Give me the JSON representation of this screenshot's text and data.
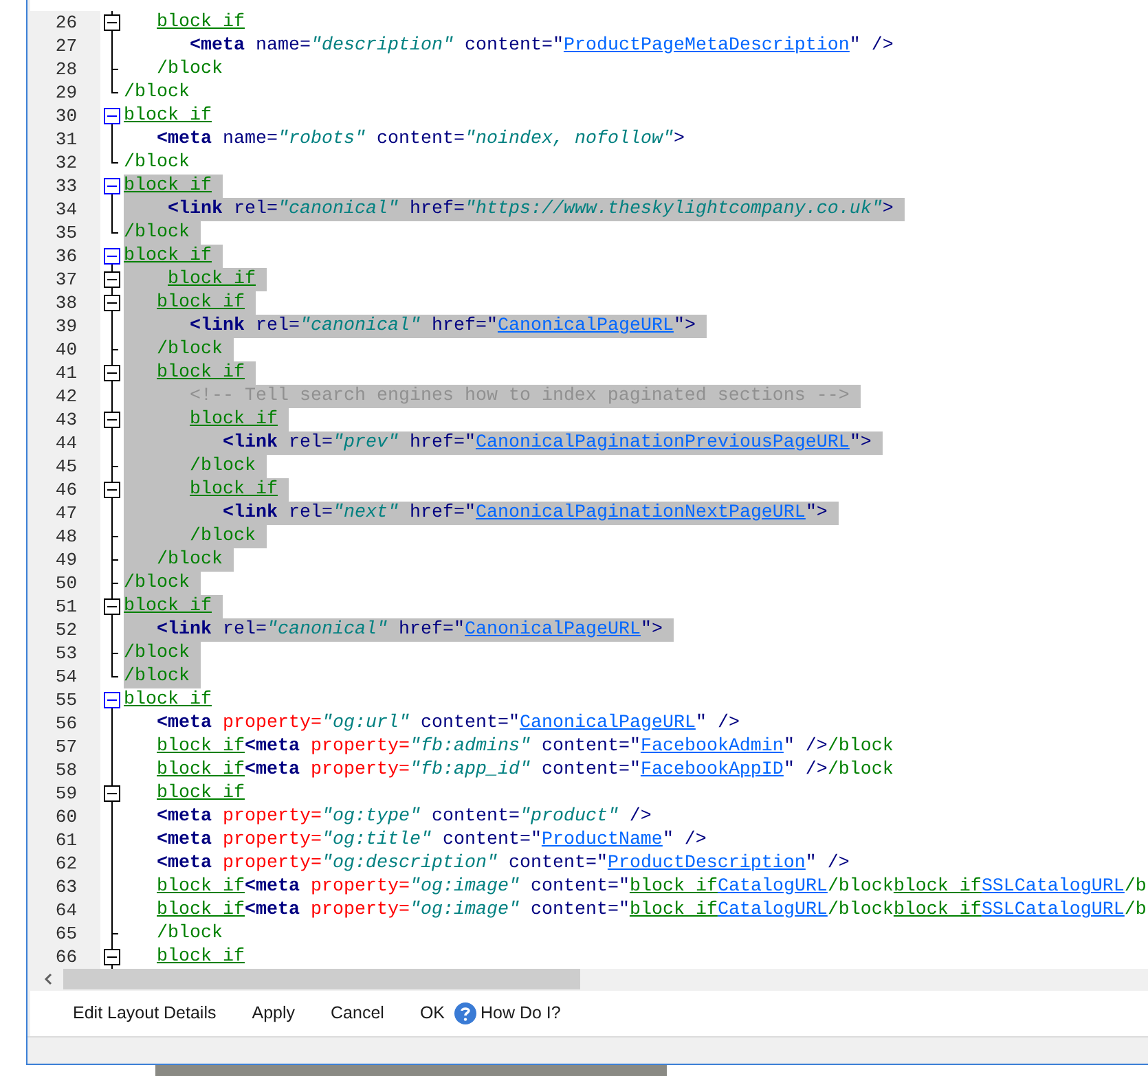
{
  "editor": {
    "lines": [
      {
        "number": "26",
        "kind": "open",
        "selected": false,
        "segments": [
          {
            "kind": "block",
            "text": "   block if"
          }
        ]
      },
      {
        "number": "27",
        "kind": "line",
        "selected": false,
        "segments": [
          {
            "kind": "tag",
            "text": "      <meta"
          },
          {
            "kind": "attr",
            "text": " name="
          },
          {
            "kind": "value",
            "text": "\"description\""
          },
          {
            "kind": "attr",
            "text": " content="
          },
          {
            "kind": "punct",
            "text": "\""
          },
          {
            "kind": "ref",
            "text": "ProductPageMetaDescription"
          },
          {
            "kind": "punct",
            "text": "\" />"
          }
        ]
      },
      {
        "number": "28",
        "kind": "tick",
        "selected": false,
        "segments": [
          {
            "kind": "end",
            "text": "   /block"
          }
        ]
      },
      {
        "number": "29",
        "kind": "end",
        "selected": false,
        "segments": [
          {
            "kind": "end",
            "text": "/block"
          }
        ]
      },
      {
        "number": "30",
        "kind": "open-top",
        "selected": false,
        "segments": [
          {
            "kind": "block",
            "text": "block if"
          }
        ]
      },
      {
        "number": "31",
        "kind": "line",
        "selected": false,
        "segments": [
          {
            "kind": "tag",
            "text": "   <meta"
          },
          {
            "kind": "attr",
            "text": " name="
          },
          {
            "kind": "value",
            "text": "\"robots\""
          },
          {
            "kind": "attr",
            "text": " content="
          },
          {
            "kind": "value",
            "text": "\"noindex, nofollow\""
          },
          {
            "kind": "punct",
            "text": ">"
          }
        ]
      },
      {
        "number": "32",
        "kind": "end",
        "selected": false,
        "segments": [
          {
            "kind": "end",
            "text": "/block"
          }
        ]
      },
      {
        "number": "33",
        "kind": "open-top",
        "selected": true,
        "segments": [
          {
            "kind": "block",
            "text": "block if"
          }
        ]
      },
      {
        "number": "34",
        "kind": "line",
        "selected": true,
        "segments": [
          {
            "kind": "tag",
            "text": "    <link"
          },
          {
            "kind": "attr",
            "text": " rel="
          },
          {
            "kind": "value",
            "text": "\"canonical\""
          },
          {
            "kind": "attr",
            "text": " href="
          },
          {
            "kind": "value",
            "text": "\"https://www.theskylightcompany.co.uk\""
          },
          {
            "kind": "punct",
            "text": ">"
          }
        ]
      },
      {
        "number": "35",
        "kind": "end",
        "selected": true,
        "segments": [
          {
            "kind": "end",
            "text": "/block"
          }
        ]
      },
      {
        "number": "36",
        "kind": "open-top",
        "selected": true,
        "segments": [
          {
            "kind": "block",
            "text": "block if"
          }
        ]
      },
      {
        "number": "37",
        "kind": "open",
        "selected": true,
        "segments": [
          {
            "kind": "block",
            "text": "    block if"
          }
        ]
      },
      {
        "number": "38",
        "kind": "open",
        "selected": true,
        "segments": [
          {
            "kind": "block",
            "text": "   block if"
          }
        ]
      },
      {
        "number": "39",
        "kind": "line",
        "selected": true,
        "segments": [
          {
            "kind": "tag",
            "text": "      <link"
          },
          {
            "kind": "attr",
            "text": " rel="
          },
          {
            "kind": "value",
            "text": "\"canonical\""
          },
          {
            "kind": "attr",
            "text": " href="
          },
          {
            "kind": "punct",
            "text": "\""
          },
          {
            "kind": "ref",
            "text": "CanonicalPageURL"
          },
          {
            "kind": "punct",
            "text": "\">"
          }
        ]
      },
      {
        "number": "40",
        "kind": "tick",
        "selected": true,
        "segments": [
          {
            "kind": "end",
            "text": "   /block"
          }
        ]
      },
      {
        "number": "41",
        "kind": "open",
        "selected": true,
        "segments": [
          {
            "kind": "block",
            "text": "   block if"
          }
        ]
      },
      {
        "number": "42",
        "kind": "line",
        "selected": true,
        "segments": [
          {
            "kind": "comment",
            "text": "      <!-- Tell search engines how to index paginated sections -->"
          }
        ]
      },
      {
        "number": "43",
        "kind": "open",
        "selected": true,
        "segments": [
          {
            "kind": "block",
            "text": "      block if"
          }
        ]
      },
      {
        "number": "44",
        "kind": "line",
        "selected": true,
        "segments": [
          {
            "kind": "tag",
            "text": "         <link"
          },
          {
            "kind": "attr",
            "text": " rel="
          },
          {
            "kind": "value",
            "text": "\"prev\""
          },
          {
            "kind": "attr",
            "text": " href="
          },
          {
            "kind": "punct",
            "text": "\""
          },
          {
            "kind": "ref",
            "text": "CanonicalPaginationPreviousPageURL"
          },
          {
            "kind": "punct",
            "text": "\">"
          }
        ]
      },
      {
        "number": "45",
        "kind": "tick",
        "selected": true,
        "segments": [
          {
            "kind": "end",
            "text": "      /block"
          }
        ]
      },
      {
        "number": "46",
        "kind": "open",
        "selected": true,
        "segments": [
          {
            "kind": "block",
            "text": "      block if"
          }
        ]
      },
      {
        "number": "47",
        "kind": "line",
        "selected": true,
        "segments": [
          {
            "kind": "tag",
            "text": "         <link"
          },
          {
            "kind": "attr",
            "text": " rel="
          },
          {
            "kind": "value",
            "text": "\"next\""
          },
          {
            "kind": "attr",
            "text": " href="
          },
          {
            "kind": "punct",
            "text": "\""
          },
          {
            "kind": "ref",
            "text": "CanonicalPaginationNextPageURL"
          },
          {
            "kind": "punct",
            "text": "\">"
          }
        ]
      },
      {
        "number": "48",
        "kind": "tick",
        "selected": true,
        "segments": [
          {
            "kind": "end",
            "text": "      /block"
          }
        ]
      },
      {
        "number": "49",
        "kind": "tick",
        "selected": true,
        "segments": [
          {
            "kind": "end",
            "text": "   /block"
          }
        ]
      },
      {
        "number": "50",
        "kind": "tick",
        "selected": true,
        "segments": [
          {
            "kind": "end",
            "text": "/block"
          }
        ]
      },
      {
        "number": "51",
        "kind": "open",
        "selected": true,
        "segments": [
          {
            "kind": "block",
            "text": "block if"
          }
        ]
      },
      {
        "number": "52",
        "kind": "line",
        "selected": true,
        "segments": [
          {
            "kind": "tag",
            "text": "   <link"
          },
          {
            "kind": "attr",
            "text": " rel="
          },
          {
            "kind": "value",
            "text": "\"canonical\""
          },
          {
            "kind": "attr",
            "text": " href="
          },
          {
            "kind": "punct",
            "text": "\""
          },
          {
            "kind": "ref",
            "text": "CanonicalPageURL"
          },
          {
            "kind": "punct",
            "text": "\">"
          }
        ]
      },
      {
        "number": "53",
        "kind": "tick",
        "selected": true,
        "segments": [
          {
            "kind": "end",
            "text": "/block"
          }
        ]
      },
      {
        "number": "54",
        "kind": "end",
        "selected": true,
        "segments": [
          {
            "kind": "end",
            "text": "/block"
          }
        ]
      },
      {
        "number": "55",
        "kind": "open-top",
        "selected": false,
        "segments": [
          {
            "kind": "block",
            "text": "block if"
          }
        ]
      },
      {
        "number": "56",
        "kind": "line",
        "selected": false,
        "segments": [
          {
            "kind": "tag",
            "text": "   <meta"
          },
          {
            "kind": "prop",
            "text": " property="
          },
          {
            "kind": "value",
            "text": "\"og:url\""
          },
          {
            "kind": "attr",
            "text": " content="
          },
          {
            "kind": "punct",
            "text": "\""
          },
          {
            "kind": "ref",
            "text": "CanonicalPageURL"
          },
          {
            "kind": "punct",
            "text": "\" />"
          }
        ]
      },
      {
        "number": "57",
        "kind": "line",
        "selected": false,
        "segments": [
          {
            "kind": "block",
            "text": "   block if"
          },
          {
            "kind": "tag",
            "text": "<meta"
          },
          {
            "kind": "prop",
            "text": " property="
          },
          {
            "kind": "value",
            "text": "\"fb:admins\""
          },
          {
            "kind": "attr",
            "text": " content="
          },
          {
            "kind": "punct",
            "text": "\""
          },
          {
            "kind": "ref",
            "text": "FacebookAdmin"
          },
          {
            "kind": "punct",
            "text": "\" />"
          },
          {
            "kind": "end",
            "text": "/block"
          }
        ]
      },
      {
        "number": "58",
        "kind": "line",
        "selected": false,
        "segments": [
          {
            "kind": "block",
            "text": "   block if"
          },
          {
            "kind": "tag",
            "text": "<meta"
          },
          {
            "kind": "prop",
            "text": " property="
          },
          {
            "kind": "value",
            "text": "\"fb:app_id\""
          },
          {
            "kind": "attr",
            "text": " content="
          },
          {
            "kind": "punct",
            "text": "\""
          },
          {
            "kind": "ref",
            "text": "FacebookAppID"
          },
          {
            "kind": "punct",
            "text": "\" />"
          },
          {
            "kind": "end",
            "text": "/block"
          }
        ]
      },
      {
        "number": "59",
        "kind": "open",
        "selected": false,
        "segments": [
          {
            "kind": "block",
            "text": "   block if"
          }
        ]
      },
      {
        "number": "60",
        "kind": "line",
        "selected": false,
        "segments": [
          {
            "kind": "tag",
            "text": "   <meta"
          },
          {
            "kind": "prop",
            "text": " property="
          },
          {
            "kind": "value",
            "text": "\"og:type\""
          },
          {
            "kind": "attr",
            "text": " content="
          },
          {
            "kind": "value",
            "text": "\"product\""
          },
          {
            "kind": "punct",
            "text": " />"
          }
        ]
      },
      {
        "number": "61",
        "kind": "line",
        "selected": false,
        "segments": [
          {
            "kind": "tag",
            "text": "   <meta"
          },
          {
            "kind": "prop",
            "text": " property="
          },
          {
            "kind": "value",
            "text": "\"og:title\""
          },
          {
            "kind": "attr",
            "text": " content="
          },
          {
            "kind": "punct",
            "text": "\""
          },
          {
            "kind": "ref",
            "text": "ProductName"
          },
          {
            "kind": "punct",
            "text": "\" />"
          }
        ]
      },
      {
        "number": "62",
        "kind": "line",
        "selected": false,
        "segments": [
          {
            "kind": "tag",
            "text": "   <meta"
          },
          {
            "kind": "prop",
            "text": " property="
          },
          {
            "kind": "value",
            "text": "\"og:description\""
          },
          {
            "kind": "attr",
            "text": " content="
          },
          {
            "kind": "punct",
            "text": "\""
          },
          {
            "kind": "ref",
            "text": "ProductDescription"
          },
          {
            "kind": "punct",
            "text": "\" />"
          }
        ]
      },
      {
        "number": "63",
        "kind": "line",
        "selected": false,
        "segments": [
          {
            "kind": "block",
            "text": "   block if"
          },
          {
            "kind": "tag",
            "text": "<meta"
          },
          {
            "kind": "prop",
            "text": " property="
          },
          {
            "kind": "value",
            "text": "\"og:image\""
          },
          {
            "kind": "attr",
            "text": " content="
          },
          {
            "kind": "punct",
            "text": "\""
          },
          {
            "kind": "block",
            "text": "block if"
          },
          {
            "kind": "ref",
            "text": "CatalogURL"
          },
          {
            "kind": "end",
            "text": "/block"
          },
          {
            "kind": "block",
            "text": "block if"
          },
          {
            "kind": "ref",
            "text": "SSLCatalogURL"
          },
          {
            "kind": "end",
            "text": "/b"
          }
        ]
      },
      {
        "number": "64",
        "kind": "line",
        "selected": false,
        "segments": [
          {
            "kind": "block",
            "text": "   block if"
          },
          {
            "kind": "tag",
            "text": "<meta"
          },
          {
            "kind": "prop",
            "text": " property="
          },
          {
            "kind": "value",
            "text": "\"og:image\""
          },
          {
            "kind": "attr",
            "text": " content="
          },
          {
            "kind": "punct",
            "text": "\""
          },
          {
            "kind": "block",
            "text": "block if"
          },
          {
            "kind": "ref",
            "text": "CatalogURL"
          },
          {
            "kind": "end",
            "text": "/block"
          },
          {
            "kind": "block",
            "text": "block if"
          },
          {
            "kind": "ref",
            "text": "SSLCatalogURL"
          },
          {
            "kind": "end",
            "text": "/b"
          }
        ]
      },
      {
        "number": "65",
        "kind": "tick",
        "selected": false,
        "segments": [
          {
            "kind": "end",
            "text": "   /block"
          }
        ]
      },
      {
        "number": "66",
        "kind": "open",
        "selected": false,
        "segments": [
          {
            "kind": "block",
            "text": "   block if"
          }
        ]
      }
    ]
  },
  "buttons": [
    {
      "label": "Edit Layout Details"
    },
    {
      "label": "Apply"
    },
    {
      "label": "Cancel"
    },
    {
      "label": "OK"
    },
    {
      "label": "How Do I?",
      "kind": "help"
    }
  ]
}
